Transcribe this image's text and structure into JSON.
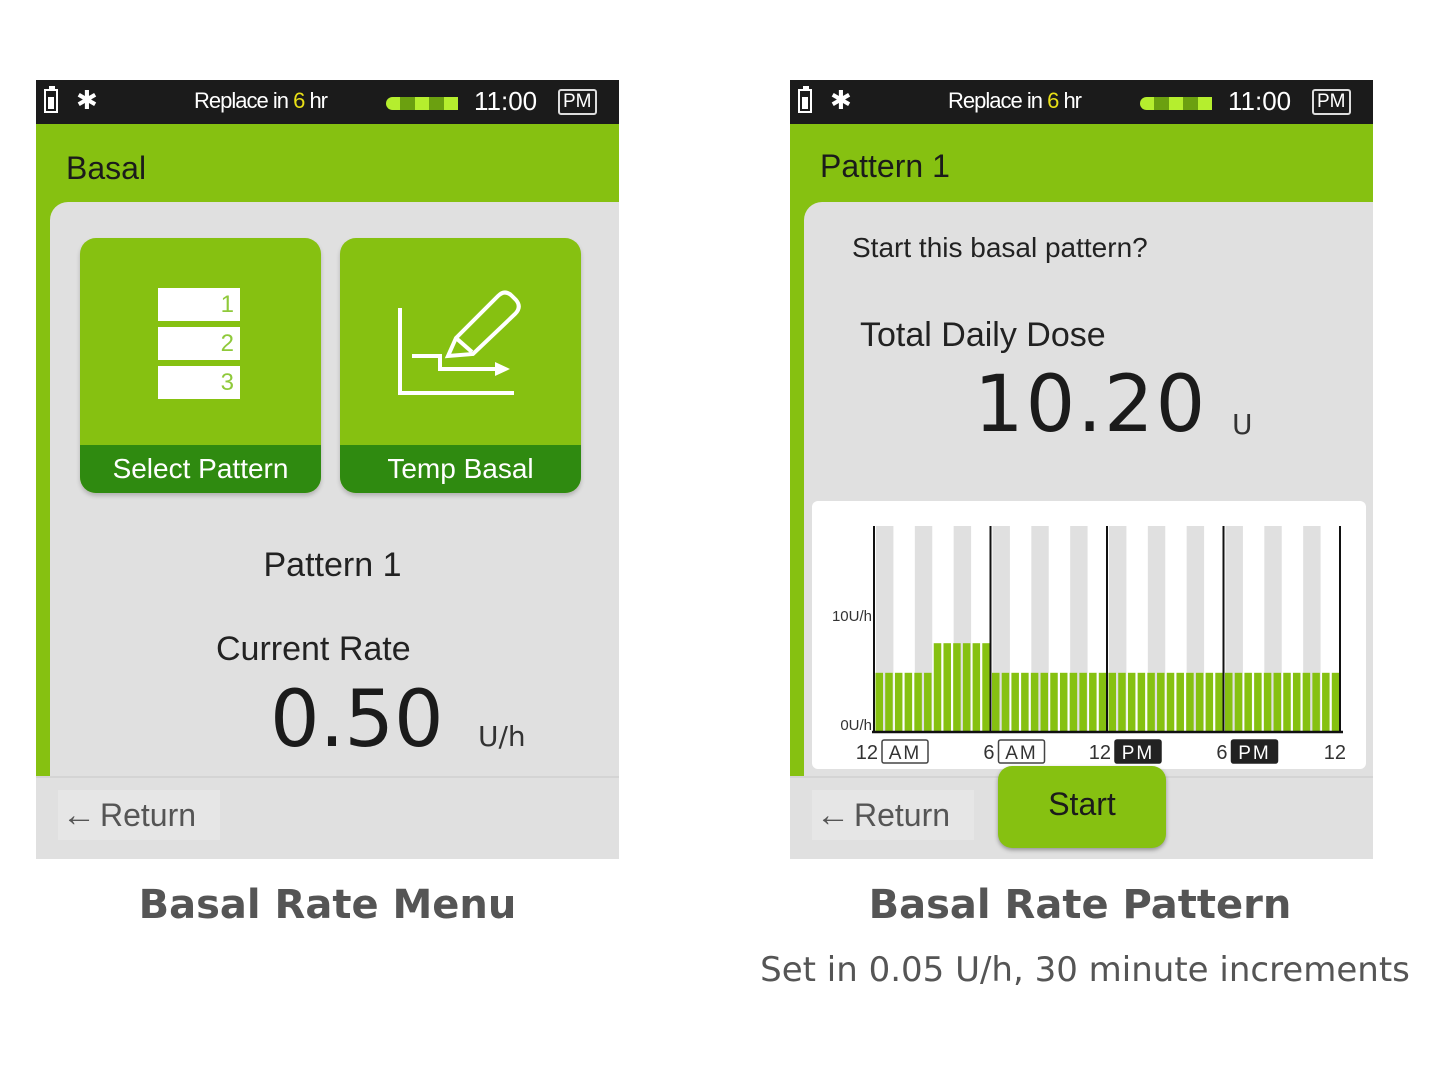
{
  "status_bar": {
    "replace_prefix": "Replace in ",
    "replace_hours": "6",
    "replace_suffix": " hr",
    "time": "11:00",
    "ampm": "PM",
    "icons": [
      "battery-icon",
      "bluetooth-icon",
      "reservoir-level-icon"
    ],
    "bluetooth_glyph": "✱",
    "reservoir_segments": 5
  },
  "colors": {
    "brand_green": "#86c111",
    "dark_green": "#2f8a10",
    "highlight_yellow": "#e8df16",
    "status_bg": "#1b1b1b"
  },
  "screen1": {
    "title": "Basal",
    "tiles": [
      {
        "label": "Select Pattern",
        "icon": "pattern-list-icon",
        "list_numbers": [
          "1",
          "2",
          "3"
        ]
      },
      {
        "label": "Temp Basal",
        "icon": "chart-edit-icon"
      }
    ],
    "pattern_name": "Pattern 1",
    "current_rate_label": "Current Rate",
    "current_rate_value": "0.50",
    "current_rate_unit": "U/h",
    "return_label": "Return",
    "caption": "Basal Rate Menu"
  },
  "screen2": {
    "title": "Pattern 1",
    "question": "Start this basal pattern?",
    "tdd_label": "Total Daily Dose",
    "tdd_value": "10.20",
    "tdd_unit": "U",
    "return_label": "Return",
    "start_label": "Start",
    "caption": "Basal Rate Pattern",
    "subcaption": "Set in 0.05 U/h, 30 minute increments"
  },
  "chart_data": {
    "type": "bar",
    "title": "",
    "xlabel": "",
    "ylabel": "",
    "y_tick_labels": [
      "0U/h",
      "10U/h"
    ],
    "x_tick_labels": [
      {
        "num": "12",
        "period": "AM",
        "style": "outline"
      },
      {
        "num": "6",
        "period": "AM",
        "style": "outline"
      },
      {
        "num": "12",
        "period": "PM",
        "style": "filled"
      },
      {
        "num": "6",
        "period": "PM",
        "style": "filled"
      },
      {
        "num": "12",
        "period": "",
        "style": "none"
      }
    ],
    "interval_minutes": 30,
    "values": [
      0.4,
      0.4,
      0.4,
      0.4,
      0.4,
      0.4,
      0.6,
      0.6,
      0.6,
      0.6,
      0.6,
      0.6,
      0.4,
      0.4,
      0.4,
      0.4,
      0.4,
      0.4,
      0.4,
      0.4,
      0.4,
      0.4,
      0.4,
      0.4,
      0.4,
      0.4,
      0.4,
      0.4,
      0.4,
      0.4,
      0.4,
      0.4,
      0.4,
      0.4,
      0.4,
      0.4,
      0.4,
      0.4,
      0.4,
      0.4,
      0.4,
      0.4,
      0.4,
      0.4,
      0.4,
      0.4,
      0.4,
      0.4
    ],
    "grid": true
  }
}
